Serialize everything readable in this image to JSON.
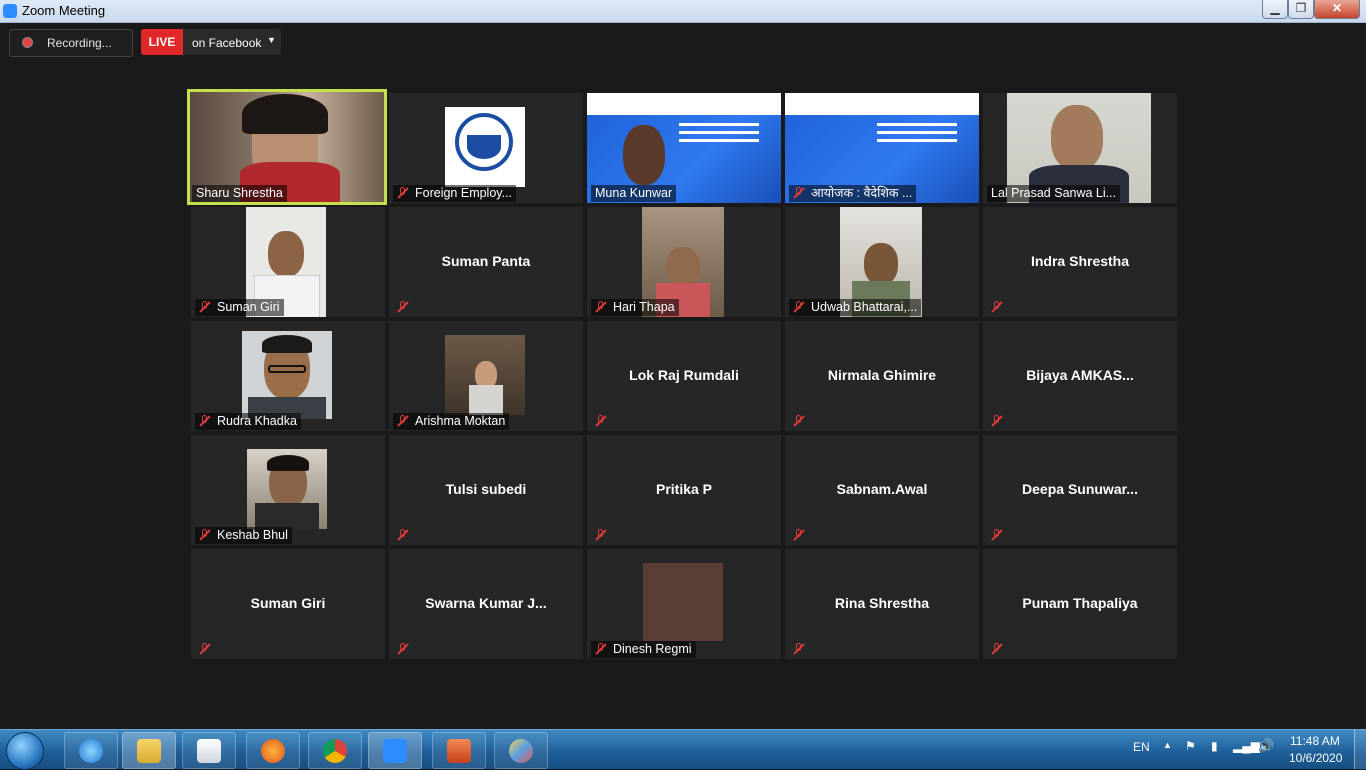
{
  "window": {
    "title": "Zoom Meeting"
  },
  "toolbar": {
    "recording_label": "Recording...",
    "live_badge": "LIVE",
    "live_target": "on Facebook"
  },
  "participants": [
    {
      "name": "Sharu Shrestha",
      "video": true,
      "active": true,
      "muted": false
    },
    {
      "name": "Foreign Employ...",
      "video": true,
      "muted": true
    },
    {
      "name": "Muna Kunwar",
      "video": true,
      "muted": false
    },
    {
      "name": "आयोजक : वैदेशिक ...",
      "video": true,
      "muted": true
    },
    {
      "name": "Lal Prasad Sanwa Li...",
      "video": true,
      "muted": false
    },
    {
      "name": "Suman Giri",
      "video": true,
      "muted": true
    },
    {
      "name": "Suman Panta",
      "video": false,
      "muted": true
    },
    {
      "name": "Hari Thapa",
      "video": true,
      "muted": true
    },
    {
      "name": "Udwab Bhattarai,...",
      "video": true,
      "muted": true
    },
    {
      "name": "Indra Shrestha",
      "video": false,
      "muted": true
    },
    {
      "name": "Rudra Khadka",
      "video": true,
      "muted": true
    },
    {
      "name": "Arishma Moktan",
      "video": true,
      "muted": true
    },
    {
      "name": "Lok Raj Rumdali",
      "video": false,
      "muted": true
    },
    {
      "name": "Nirmala Ghimire",
      "video": false,
      "muted": true
    },
    {
      "name": "Bijaya  AMKAS...",
      "video": false,
      "muted": true
    },
    {
      "name": "Keshab Bhul",
      "video": true,
      "muted": true
    },
    {
      "name": "Tulsi subedi",
      "video": false,
      "muted": true
    },
    {
      "name": "Pritika P",
      "video": false,
      "muted": true
    },
    {
      "name": "Sabnam.Awal",
      "video": false,
      "muted": true
    },
    {
      "name": "Deepa  Sunuwar...",
      "video": false,
      "muted": true
    },
    {
      "name": "Suman Giri",
      "video": false,
      "muted": true
    },
    {
      "name": "Swarna  Kumar  J...",
      "video": false,
      "muted": true
    },
    {
      "name": "Dinesh Regmi",
      "video": true,
      "muted": true
    },
    {
      "name": "Rina Shrestha",
      "video": false,
      "muted": true
    },
    {
      "name": "Punam Thapaliya",
      "video": false,
      "muted": true
    }
  ],
  "taskbar": {
    "language": "EN",
    "time": "11:48 AM",
    "date": "10/6/2020",
    "pinned_icons": [
      "internet-explorer-icon",
      "file-explorer-icon",
      "media-player-icon",
      "firefox-icon",
      "chrome-icon",
      "zoom-icon",
      "powerpoint-icon",
      "paint-icon"
    ]
  }
}
